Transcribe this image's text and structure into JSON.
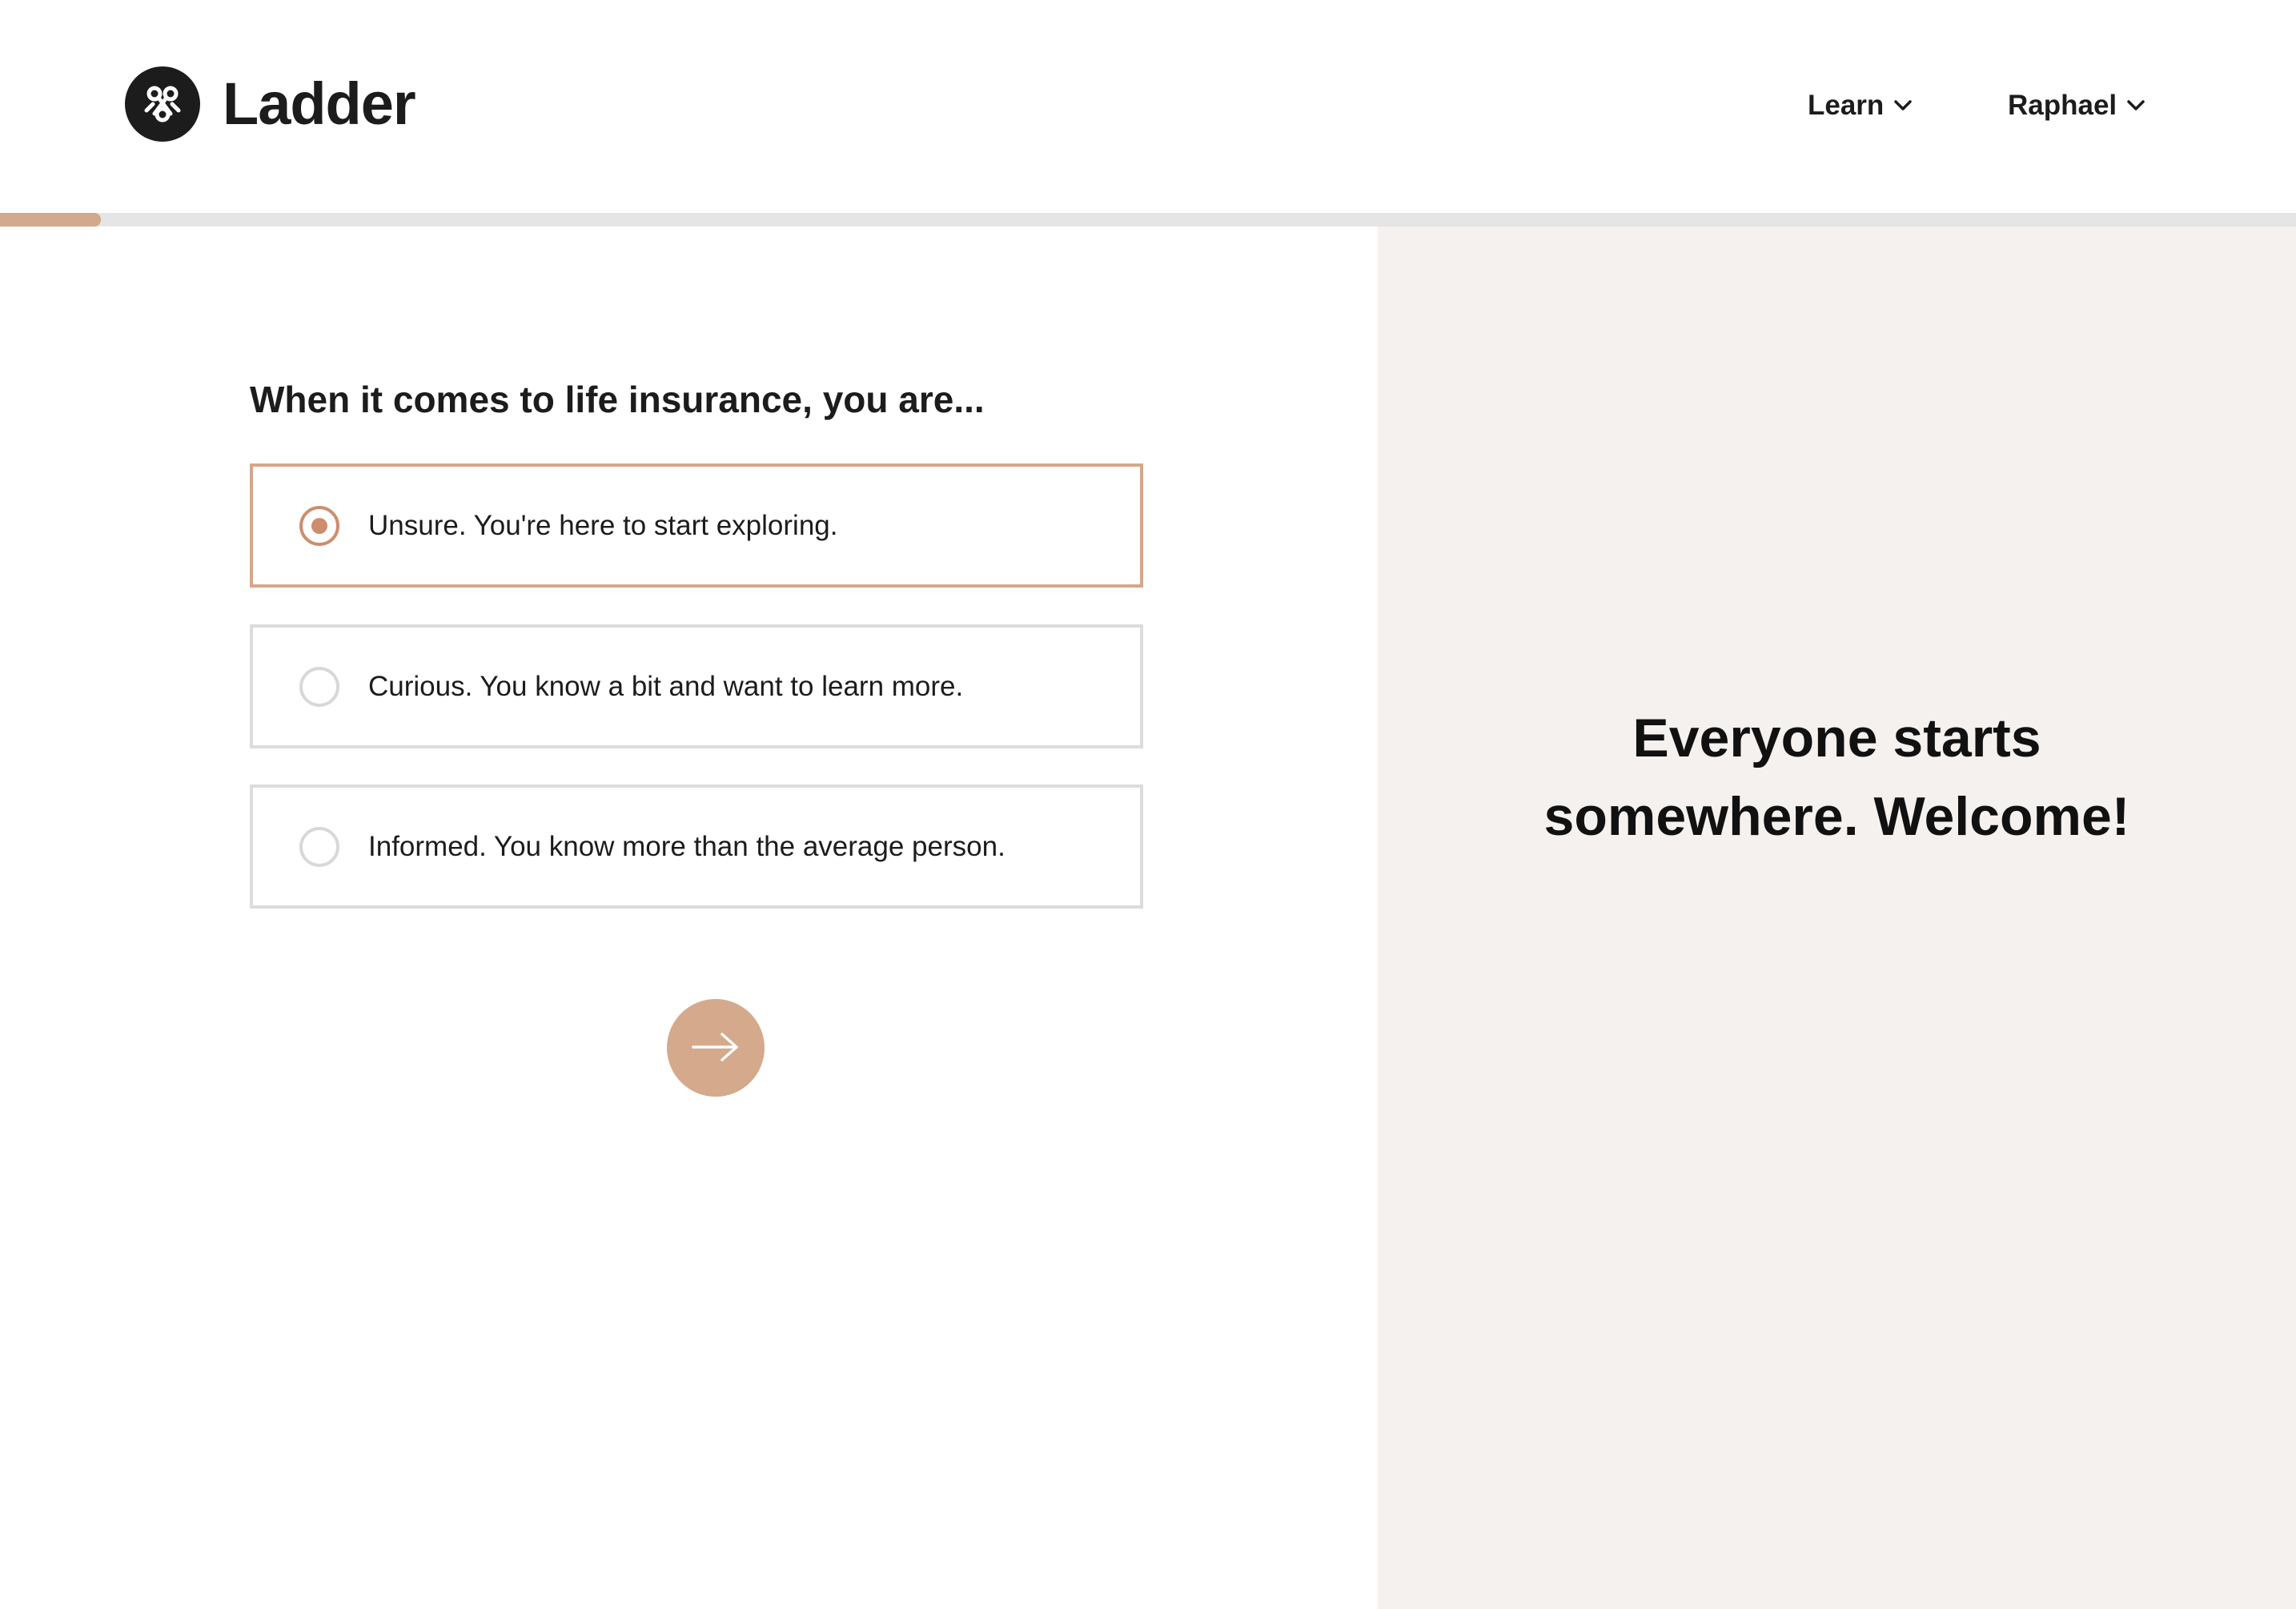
{
  "header": {
    "brand": "Ladder",
    "logo_icon": "ladder-knot-icon",
    "nav": [
      {
        "label": "Learn",
        "icon": "chevron-down-icon"
      },
      {
        "label": "Raphael",
        "icon": "chevron-down-icon"
      }
    ]
  },
  "progress": {
    "fraction": 0.044
  },
  "question": {
    "title": "When it comes to life insurance, you are...",
    "options": [
      {
        "label": "Unsure. You're here to start exploring.",
        "selected": true
      },
      {
        "label": "Curious. You know a bit and want to learn more.",
        "selected": false
      },
      {
        "label": "Informed. You know more than the average person.",
        "selected": false
      }
    ],
    "next_icon": "arrow-right-icon"
  },
  "side_panel": {
    "line1": "Everyone starts",
    "line2": "somewhere. Welcome!"
  },
  "colors": {
    "accent": "#d4a98c",
    "accent_dark": "#cc8e6f",
    "panel_bg": "#f5f1ee",
    "text": "#1c1c1c"
  }
}
